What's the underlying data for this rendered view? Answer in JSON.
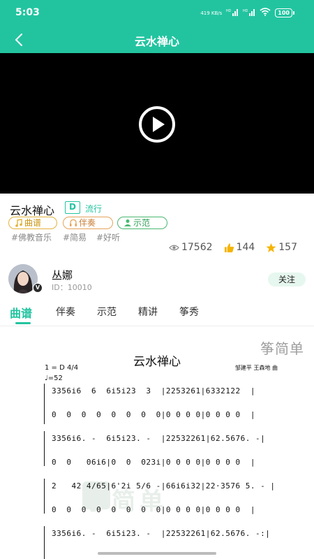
{
  "status_bar": {
    "time": "5:03",
    "net_speed": "419\nKB/s",
    "signal_1": "HD",
    "signal_2": "HD",
    "battery": "100"
  },
  "nav": {
    "title": "云水禅心"
  },
  "song": {
    "title": "云水禅心",
    "key": "D",
    "genre": "流行",
    "pills": {
      "score": "曲谱",
      "accompaniment": "伴奏",
      "demo": "示范"
    },
    "tags": [
      "#佛教音乐",
      "#简易",
      "#好听"
    ],
    "stats": {
      "views": "17562",
      "likes": "144",
      "favorites": "157"
    }
  },
  "author": {
    "name": "丛娜",
    "id": "ID：10010",
    "follow_label": "关注",
    "badge": "V"
  },
  "tabs": [
    "曲谱",
    "伴奏",
    "示范",
    "精讲",
    "筝秀"
  ],
  "sheet": {
    "brand": "筝简单",
    "title": "云水禅心",
    "key_signature": "1 = D 4/4",
    "tempo": "♩=52",
    "composer": "邹建平 王森地  曲",
    "rows": [
      "3356i6  6  6i5i23  3  |2253261|6332122  |",
      "0  0  0  0  0  0  0  0|0 0 0 0|0 0 0 0  |",
      "3356i6. -  6i5i23. -  |22532261|62.5676. -|",
      "0  0   06i6|0  0  023i|0 0 0 0|0 0 0 0  |",
      "2   42 4/65|6'2i 5/6 -|66i6i32|22·3576 5. - |",
      "0  0  0  0  0  0  0  0|0 0 0 0|0 0 0 0  |",
      "3356i6. -  6i5i23. -  |22532261|62.5676. -:|"
    ],
    "watermark": "筝简单"
  },
  "colors": {
    "accent": "#22c4a0",
    "score_pill": "#e2b33c",
    "accomp_pill": "#e4a35a",
    "demo_pill": "#48b870",
    "star": "#f5b400",
    "like": "#f5b400"
  }
}
